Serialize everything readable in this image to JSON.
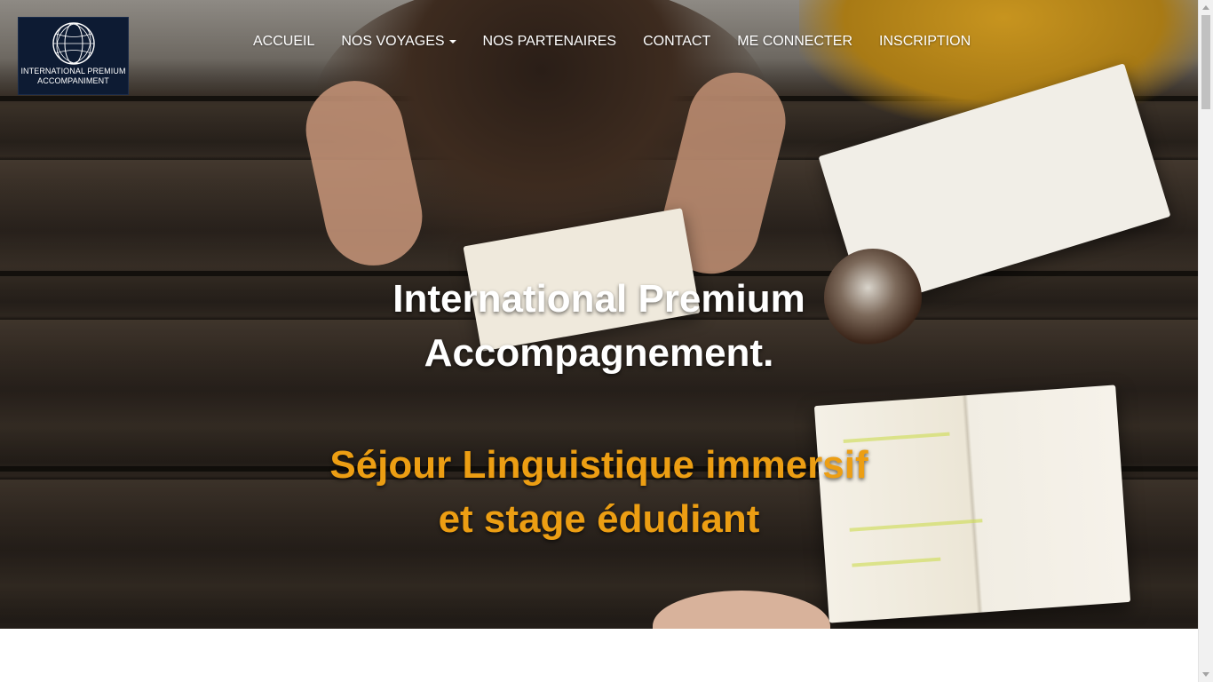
{
  "logo": {
    "line1": "INTERNATIONAL PREMIUM",
    "line2": "ACCOMPANIMENT",
    "icon": "globe-icon"
  },
  "nav": {
    "items": [
      {
        "label": "ACCUEIL"
      },
      {
        "label": "NOS VOYAGES",
        "dropdown": true
      },
      {
        "label": "NOS PARTENAIRES"
      },
      {
        "label": "CONTACT"
      },
      {
        "label": "ME CONNECTER"
      },
      {
        "label": "INSCRIPTION"
      }
    ]
  },
  "hero": {
    "title_line1": "International Premium",
    "title_line2": "Accompagnement.",
    "subtitle_line1": "Séjour Linguistique immersif",
    "subtitle_line2": "et stage édudiant"
  },
  "colors": {
    "subtitle": "#ec9e13",
    "logo_background": "#0d1b33",
    "nav_text": "#ffffff"
  }
}
